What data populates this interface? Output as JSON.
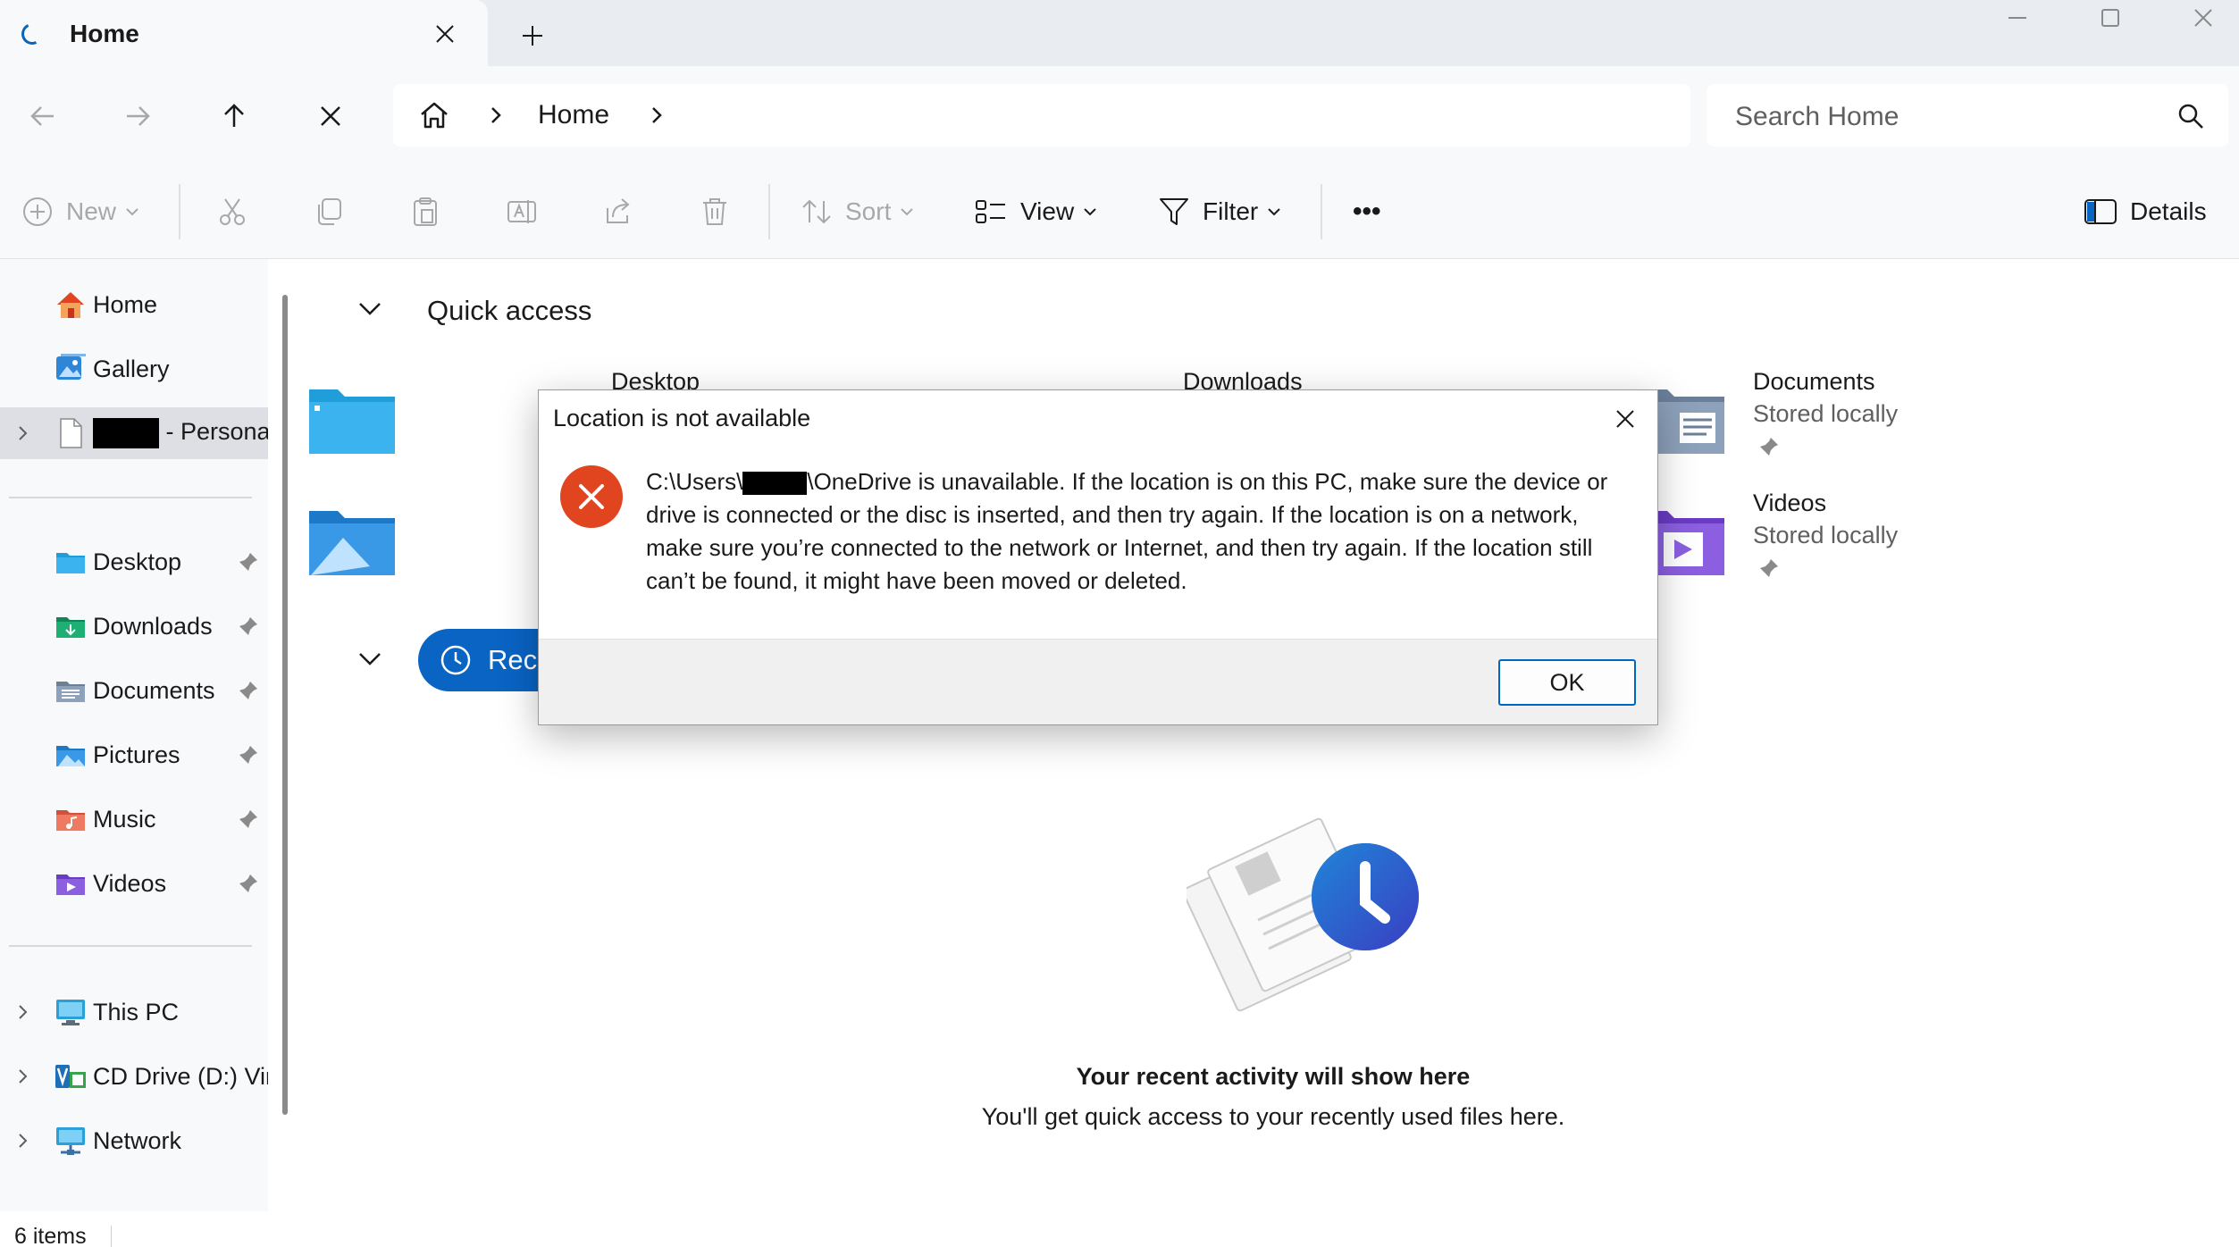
{
  "window": {
    "tab_title": "Home",
    "minimize_icon": "minimize-icon",
    "maximize_icon": "maximize-icon",
    "close_icon": "close-icon"
  },
  "address_bar": {
    "crumbs": [
      "Home"
    ],
    "search_placeholder": "Search Home"
  },
  "command_bar": {
    "new_label": "New",
    "sort_label": "Sort",
    "view_label": "View",
    "filter_label": "Filter",
    "more_label": "•••",
    "details_label": "Details"
  },
  "sidebar": {
    "top_items": [
      {
        "label": "Home",
        "icon": "home-icon"
      },
      {
        "label": "Gallery",
        "icon": "gallery-icon"
      },
      {
        "label": " - Personal",
        "icon": "document-icon",
        "redacted_prefix": true
      }
    ],
    "pinned_items": [
      {
        "label": "Desktop",
        "icon": "desktop-folder-icon"
      },
      {
        "label": "Downloads",
        "icon": "downloads-folder-icon"
      },
      {
        "label": "Documents",
        "icon": "documents-folder-icon"
      },
      {
        "label": "Pictures",
        "icon": "pictures-folder-icon"
      },
      {
        "label": "Music",
        "icon": "music-folder-icon"
      },
      {
        "label": "Videos",
        "icon": "videos-folder-icon"
      }
    ],
    "bottom_items": [
      {
        "label": "This PC",
        "icon": "pc-icon"
      },
      {
        "label": "CD Drive (D:) Vir",
        "icon": "cd-drive-icon"
      },
      {
        "label": "Network",
        "icon": "network-icon"
      }
    ]
  },
  "status_bar": {
    "item_count": "6 items"
  },
  "main": {
    "quick_access_title": "Quick access",
    "quick_access": [
      {
        "name": "Desktop",
        "sub": ""
      },
      {
        "name": "Downloads",
        "sub": ""
      },
      {
        "name": "Documents",
        "sub": "Stored locally"
      },
      {
        "name": "Videos",
        "sub": "Stored locally"
      }
    ],
    "recent_pill_label": "Rece",
    "empty_title": "Your recent activity will show here",
    "empty_subtitle": "You'll get quick access to your recently used files here."
  },
  "dialog": {
    "title": "Location is not available",
    "message_prefix": "C:\\Users\\",
    "message_rest": "\\OneDrive is unavailable. If the location is on this PC, make sure the device or drive is connected or the disc is inserted, and then try again. If the location is on a network, make sure you’re connected to the network or Internet, and then try again. If the location still can’t be found, it might have been moved or deleted.",
    "ok_label": "OK"
  },
  "colors": {
    "accent": "#0a64c4",
    "error": "#e0451f"
  }
}
